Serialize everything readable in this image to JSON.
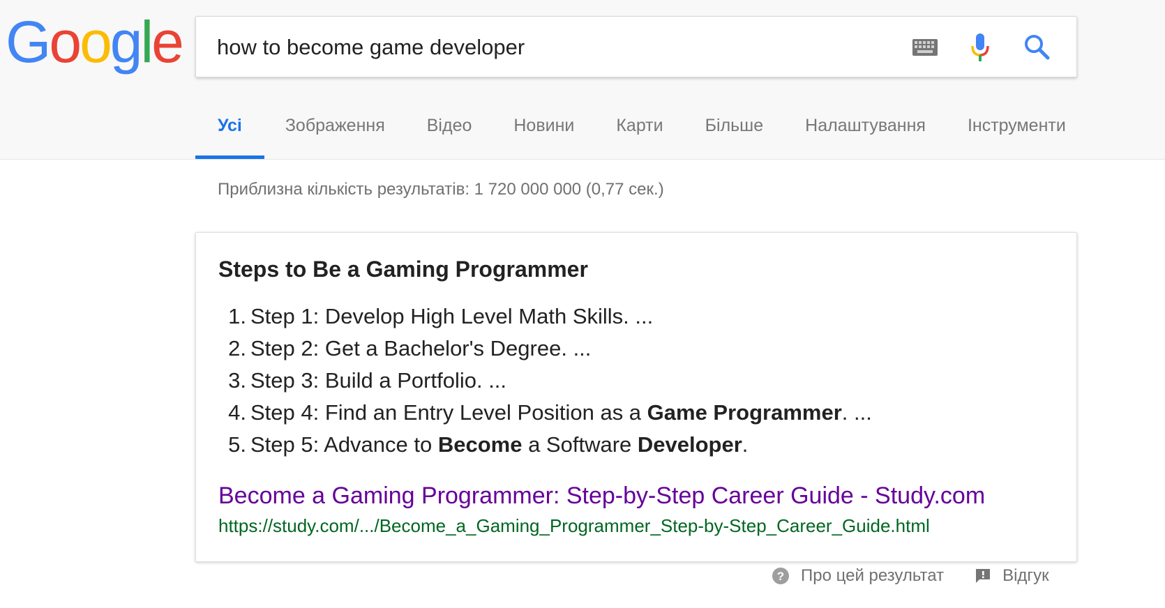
{
  "logo": {
    "letters": [
      {
        "ch": "G",
        "color": "#4285F4"
      },
      {
        "ch": "o",
        "color": "#EA4335"
      },
      {
        "ch": "o",
        "color": "#FBBC05"
      },
      {
        "ch": "g",
        "color": "#4285F4"
      },
      {
        "ch": "l",
        "color": "#34A853"
      },
      {
        "ch": "e",
        "color": "#EA4335"
      }
    ]
  },
  "search": {
    "query": "how to become game developer"
  },
  "tabs": [
    {
      "label": "Усі",
      "active": true
    },
    {
      "label": "Зображення",
      "active": false
    },
    {
      "label": "Відео",
      "active": false
    },
    {
      "label": "Новини",
      "active": false
    },
    {
      "label": "Карти",
      "active": false
    },
    {
      "label": "Більше",
      "active": false
    },
    {
      "label": "Налаштування",
      "active": false
    },
    {
      "label": "Інструменти",
      "active": false
    }
  ],
  "stats": "Приблизна кількість результатів: 1 720 000 000 (0,77 сек.)",
  "snippet": {
    "title": "Steps to Be a Gaming Programmer",
    "steps": [
      {
        "num": "1.",
        "parts": [
          {
            "text": "Step 1: Develop High Level Math Skills. ...",
            "bold": false
          }
        ]
      },
      {
        "num": "2.",
        "parts": [
          {
            "text": "Step 2: Get a Bachelor's Degree. ...",
            "bold": false
          }
        ]
      },
      {
        "num": "3.",
        "parts": [
          {
            "text": "Step 3: Build a Portfolio. ...",
            "bold": false
          }
        ]
      },
      {
        "num": "4.",
        "parts": [
          {
            "text": "Step 4: Find an Entry Level Position as a ",
            "bold": false
          },
          {
            "text": "Game Programmer",
            "bold": true
          },
          {
            "text": ". ...",
            "bold": false
          }
        ]
      },
      {
        "num": "5.",
        "parts": [
          {
            "text": "Step 5: Advance to ",
            "bold": false
          },
          {
            "text": "Become",
            "bold": true
          },
          {
            "text": " a Software ",
            "bold": false
          },
          {
            "text": "Developer",
            "bold": true
          },
          {
            "text": ".",
            "bold": false
          }
        ]
      }
    ],
    "result_title": "Become a Gaming Programmer: Step-by-Step Career Guide - Study.com",
    "result_url": "https://study.com/.../Become_a_Gaming_Programmer_Step-by-Step_Career_Guide.html"
  },
  "footer": {
    "about_label": "Про цей результат",
    "feedback_label": "Відгук"
  },
  "colors": {
    "accent_blue": "#1a73e8",
    "link_visited": "#660099",
    "url_green": "#006621"
  },
  "icons": {
    "keyboard": "keyboard-icon",
    "mic": "microphone-icon",
    "search": "search-icon",
    "help": "help-circle-icon",
    "feedback": "feedback-icon"
  }
}
